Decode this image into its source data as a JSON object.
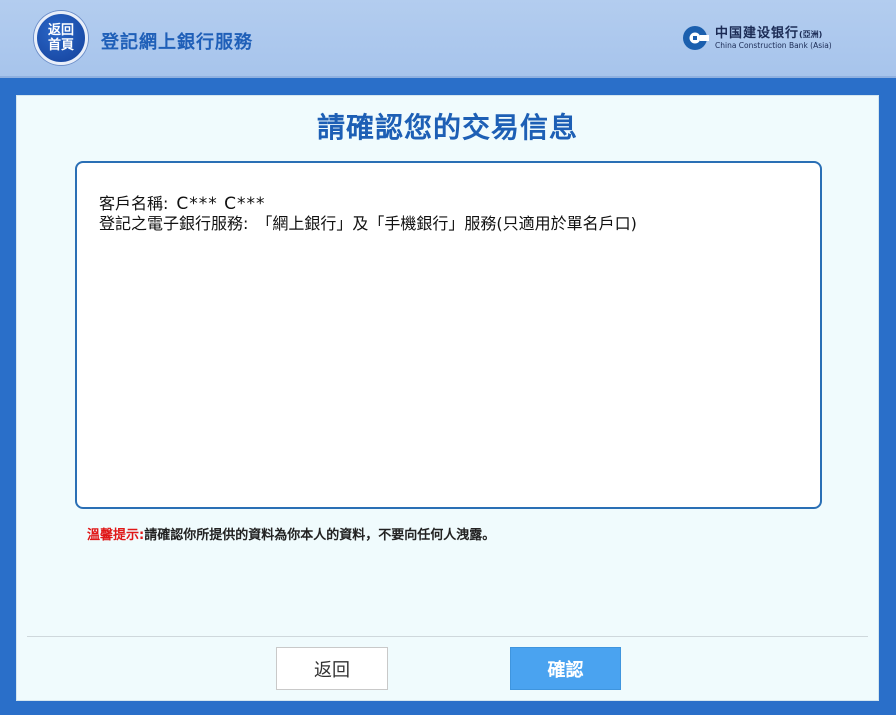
{
  "header": {
    "home_label_line1": "返回",
    "home_label_line2": "首頁",
    "title": "登記網上銀行服務",
    "bank_name_cn": "中国建设银行",
    "bank_name_cn_suffix": "(亞洲)",
    "bank_name_en": "China Construction Bank (Asia)"
  },
  "main": {
    "title": "請確認您的交易信息",
    "customer_name_label": "客戶名稱:",
    "customer_name_value": "C*** C***",
    "service_label": "登記之電子銀行服務:",
    "service_value": "「網上銀行」及「手機銀行」服務(只適用於單名戶口)",
    "hint_label": "溫馨提示:",
    "hint_text": "請確認你所提供的資料為你本人的資料，不要向任何人洩露。"
  },
  "buttons": {
    "back_label": "返回",
    "confirm_label": "確認"
  },
  "colors": {
    "header_bg": "#aec8ee",
    "title_blue": "#1d5fb5",
    "confirm_btn": "#4aa3f0",
    "hint_red": "#e01818",
    "frame_blue": "#2a6fc9"
  }
}
